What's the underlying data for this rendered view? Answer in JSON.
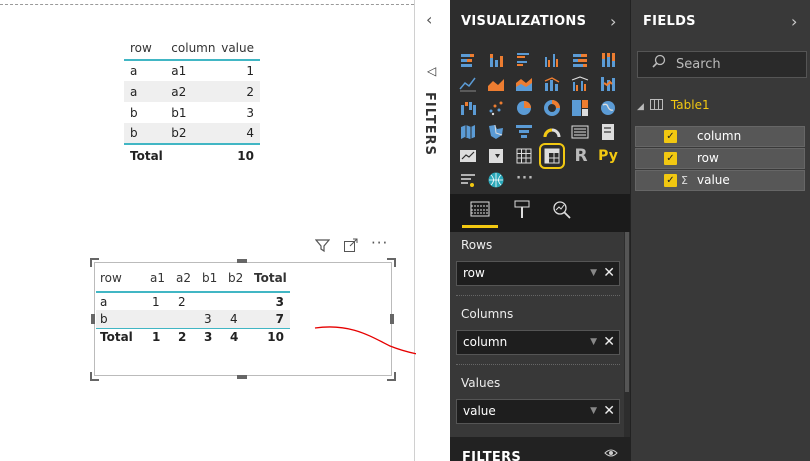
{
  "top_table": {
    "headers": [
      "row",
      "column",
      "value"
    ],
    "rows": [
      [
        "a",
        "a1",
        "1"
      ],
      [
        "a",
        "a2",
        "2"
      ],
      [
        "b",
        "b1",
        "3"
      ],
      [
        "b",
        "b2",
        "4"
      ]
    ],
    "total": [
      "Total",
      "",
      "10"
    ]
  },
  "matrix": {
    "headers": [
      "row",
      "a1",
      "a2",
      "b1",
      "b2",
      "Total"
    ],
    "rows": [
      [
        "a",
        "1",
        "2",
        "",
        "",
        "3"
      ],
      [
        "b",
        "",
        "",
        "3",
        "4",
        "7"
      ]
    ],
    "total": [
      "Total",
      "1",
      "2",
      "3",
      "4",
      "10"
    ]
  },
  "filters_strip": {
    "label": "FILTERS"
  },
  "visualizations": {
    "title": "VISUALIZATIONS",
    "r_label": "R",
    "py_label": "Py",
    "more_label": "···",
    "wells": [
      {
        "label": "Rows",
        "field": "row"
      },
      {
        "label": "Columns",
        "field": "column"
      },
      {
        "label": "Values",
        "field": "value"
      }
    ],
    "footer_label": "FILTERS"
  },
  "fields": {
    "title": "FIELDS",
    "search_placeholder": "Search",
    "table_name": "Table1",
    "items": [
      {
        "name": "column",
        "sigma": ""
      },
      {
        "name": "row",
        "sigma": ""
      },
      {
        "name": "value",
        "sigma": "Σ"
      }
    ]
  },
  "colors": {
    "accent": "#f2c811",
    "table_line": "#41b6c4",
    "annotation_arrow": "#e60000"
  }
}
